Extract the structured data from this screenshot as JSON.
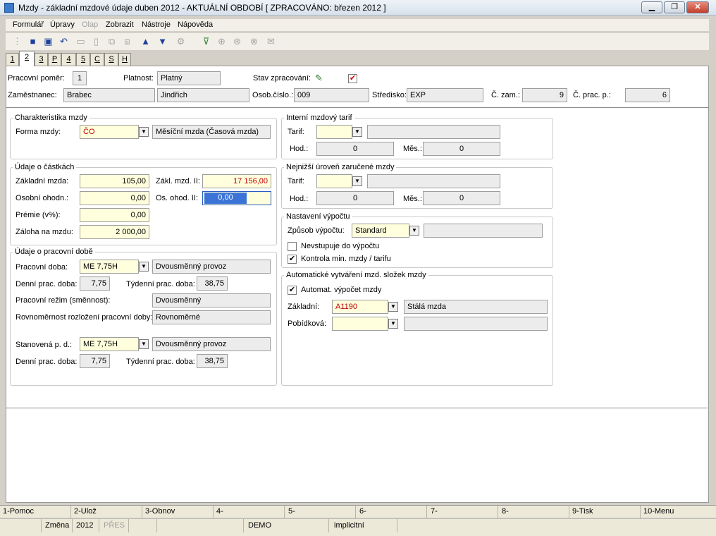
{
  "window": {
    "title": "Mzdy - základní mzdové údaje        duben 2012 - AKTUÁLNÍ OBDOBÍ [ ZPRACOVÁNO: březen 2012 ]",
    "min": "▁",
    "restore": "❐",
    "close": "✕"
  },
  "menu": [
    "Formulář",
    "Úpravy",
    "Olap",
    "Zobrazit",
    "Nástroje",
    "Nápověda"
  ],
  "toolbar": {
    "icons": [
      "tree-icon",
      "save-icon",
      "save-all-icon",
      "undo-icon",
      "open-folder-icon",
      "new-document-icon",
      "copy-icon",
      "paste-icon",
      "arrow-up-icon",
      "arrow-down-icon",
      "tools-icon",
      "filter-icon",
      "binoculars-icon",
      "find-next-icon",
      "find-prev-icon",
      "mail-icon"
    ],
    "glyphs": [
      "⋮",
      "■",
      "▣",
      "↶",
      "▭",
      "▯",
      "⧉",
      "⧈",
      "▲",
      "▼",
      "⚙",
      "⊽",
      "⊕",
      "⊛",
      "⊗",
      "✉"
    ]
  },
  "tabs": [
    "1",
    "2",
    "3",
    "P",
    "4",
    "5",
    "C",
    "S",
    "H"
  ],
  "header": {
    "pracovni_pomer_label": "Pracovní poměr:",
    "pracovni_pomer": "1",
    "platnost_label": "Platnost:",
    "platnost": "Platný",
    "stav_label": "Stav zpracování:",
    "stav_check": "✔",
    "doc_icon": "✎",
    "zamestnanec_label": "Zaměstnanec:",
    "prijmeni": "Brabec",
    "jmeno": "Jindřich",
    "osob_cislo_label": "Osob.číslo.:",
    "osob_cislo": "009",
    "stredisko_label": "Středisko:",
    "stredisko": "EXP",
    "c_zam_label": "Č. zam.:",
    "c_zam": "9",
    "c_prac_p_label": "Č. prac. p.:",
    "c_prac_p": "6"
  },
  "charakteristika": {
    "title": "Charakteristika mzdy",
    "forma_label": "Forma mzdy:",
    "forma": "ČO",
    "forma_desc": "Měsíční mzda (Časová mzda)"
  },
  "castky": {
    "title": "Údaje o částkách",
    "zakladni_label": "Základní mzda:",
    "zakladni": "105,00",
    "zakl_ii_label": "Zákl. mzd. II:",
    "zakl_ii": "17 156,00",
    "osobni_label": "Osobní ohodn.:",
    "osobni": "0,00",
    "os_ohod_ii_label": "Os. ohod. II:",
    "os_ohod_ii": "0,00",
    "premie_label": "Prémie (v%):",
    "premie": "0,00",
    "zaloha_label": "Záloha na mzdu:",
    "zaloha": "2 000,00"
  },
  "pracovni_doba": {
    "title": "Údaje o pracovní době",
    "doba_label": "Pracovní doba:",
    "doba": "ME 7,75H",
    "doba_desc": "Dvousměnný provoz",
    "denni_label": "Denní prac. doba:",
    "denni": "7,75",
    "tydenni_label": "Týdenní prac. doba:",
    "tydenni": "38,75",
    "rezim_label": "Pracovní režim (směnnost):",
    "rezim": "Dvousměnný",
    "rovnomernost_label": "Rovnoměrnost rozložení pracovní doby:",
    "rovnomernost": "Rovnoměrné",
    "stanovena_label": "Stanovená p. d.:",
    "stanovena": "ME 7,75H",
    "stanovena_desc": "Dvousměnný provoz",
    "denni2_label": "Denní prac. doba:",
    "denni2": "7,75",
    "tydenni2_label": "Týdenní prac. doba:",
    "tydenni2": "38,75"
  },
  "interni_tarif": {
    "title": "Interní mzdový tarif",
    "tarif_label": "Tarif:",
    "tarif": "",
    "tarif_desc": "",
    "hod_label": "Hod.:",
    "hod": "0",
    "mes_label": "Měs.:",
    "mes": "0"
  },
  "nejnizsi": {
    "title": "Nejnižší úroveň zaručené mzdy",
    "tarif_label": "Tarif:",
    "tarif": "",
    "tarif_desc": "",
    "hod_label": "Hod.:",
    "hod": "0",
    "mes_label": "Měs.:",
    "mes": "0"
  },
  "nastaveni": {
    "title": "Nastavení výpočtu",
    "zpusob_label": "Způsob výpočtu:",
    "zpusob": "Standard",
    "zpusob_desc": "",
    "nevstupuje_label": "Nevstupuje do výpočtu",
    "nevstupuje_check": "",
    "kontrola_label": "Kontrola min. mzdy / tarifu",
    "kontrola_check": "✔"
  },
  "automaticke": {
    "title": "Automatické vytváření mzd. složek mzdy",
    "automat_label": "Automat. výpočet mzdy",
    "automat_check": "✔",
    "zakladni_label": "Základní:",
    "zakladni": "A1190",
    "zakladni_desc": "Stálá mzda",
    "pobidkova_label": "Pobídková:",
    "pobidkova": "",
    "pobidkova_desc": ""
  },
  "dropdown_glyph": "▼",
  "fkeys": [
    "1-Pomoc",
    "2-Ulož",
    "3-Obnov",
    "4-",
    "5-",
    "6-",
    "7-",
    "8-",
    "9-Tisk",
    "10-Menu"
  ],
  "status": {
    "mode": "Změna",
    "year": "2012",
    "pres": "PŘES",
    "db": "DEMO",
    "setting": "implicitní"
  }
}
